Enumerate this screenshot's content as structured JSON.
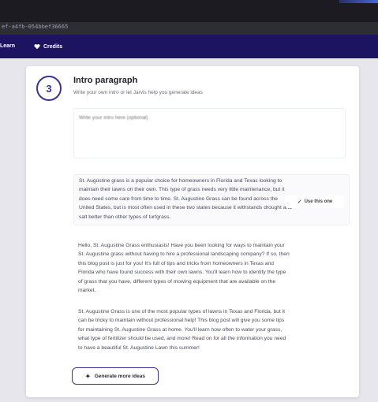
{
  "browser": {
    "address_text": "ef-a4fb-054bbef36665"
  },
  "nav": {
    "learn": {
      "label": "Learn",
      "icon": "book-icon"
    },
    "credits": {
      "label": "Credits",
      "icon": "heart-icon"
    }
  },
  "section": {
    "step_number": "3",
    "title": "Intro paragraph",
    "subtitle": "Write your own intro or let Jarvis help you generate ideas",
    "intro_placeholder": "Write your intro here (optional)"
  },
  "options": [
    {
      "text": "St. Augustine grass is a popular choice for homeowners in Florida and Texas looking to maintain their lawns on their own. This type of grass needs very little maintenance, but it does need some care from time to time. St. Augustine Grass can be found across the United States, but is most often used in these two states because it withstands drought and salt better than other types of turfgrass."
    },
    {
      "text": "Hello, St. Augustine Grass enthusiasts! Have you been looking for ways to maintain your St. Augustine grass without having to hire a professional landscaping company? If so, then this blog post is just for you! It's full of tips and tricks from homeowners in Texas and Florida who have found success with their own lawns. You'll learn how to identify the type of grass that you have, different types of mowing equipment that are available on the market."
    },
    {
      "text": "St. Augustine Grass is one of the most popular types of lawns in Texas and Florida, but it can be tricky to maintain without professional help! This blog post will give you some tips for maintaining St. Augustine Grass at home. You'll learn how often to water your grass, what type of fertilizer should be used, and more! Read on for all the information you need to have a beautiful St. Augustine Lawn this summer!"
    }
  ],
  "use_button": {
    "label": "Use this one",
    "icon": "check-icon"
  },
  "generate_button": {
    "label": "Generate more ideas",
    "icon": "sparkle-icon"
  },
  "colors": {
    "nav_bg": "#1d1461",
    "accent": "#3a3496"
  }
}
